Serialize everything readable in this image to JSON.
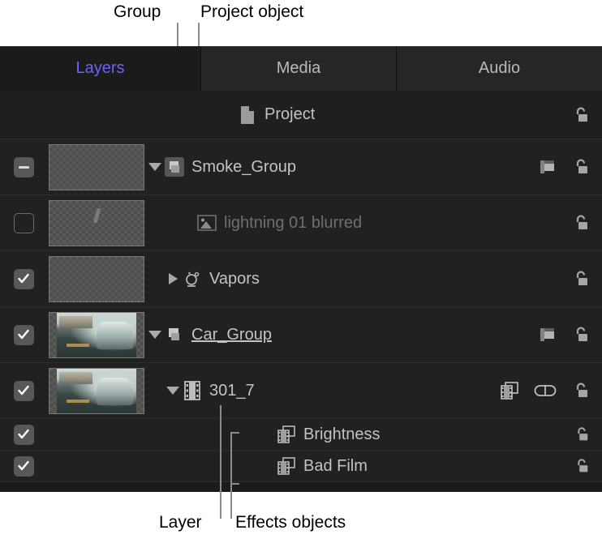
{
  "annotations": {
    "group": "Group",
    "project_object": "Project object",
    "layer": "Layer",
    "effects_objects": "Effects objects",
    "leader_color": "#8c8c8c"
  },
  "panel": {
    "background": "#1b1b1b",
    "accent": "#6b62ff",
    "tabs": [
      {
        "id": "layers",
        "label": "Layers",
        "selected": true
      },
      {
        "id": "media",
        "label": "Media",
        "selected": false
      },
      {
        "id": "audio",
        "label": "Audio",
        "selected": false
      }
    ],
    "rows": [
      {
        "id": "project",
        "name": "Project",
        "type": "project",
        "icon": "document-icon",
        "checkbox": "none",
        "thumbnail": "none",
        "disclosure": "none",
        "dimmed": false,
        "renaming": false,
        "right_icons": [
          "unlock-icon"
        ]
      },
      {
        "id": "smoke-group",
        "name": "Smoke_Group",
        "type": "group",
        "icon": "group-icon",
        "checkbox": "mixed",
        "thumbnail": "empty",
        "disclosure": "open",
        "dimmed": false,
        "renaming": false,
        "right_icons": [
          "mask-icon",
          "unlock-icon"
        ]
      },
      {
        "id": "lightning-01-blurred",
        "name": "lightning 01 blurred",
        "type": "image",
        "icon": "image-icon",
        "checkbox": "off",
        "thumbnail": "lightning",
        "disclosure": "none",
        "dimmed": true,
        "renaming": false,
        "right_icons": [
          "unlock-icon"
        ]
      },
      {
        "id": "vapors",
        "name": "Vapors",
        "type": "emitter",
        "icon": "emitter-icon",
        "checkbox": "on",
        "thumbnail": "empty",
        "disclosure": "closed",
        "dimmed": false,
        "renaming": false,
        "right_icons": [
          "unlock-icon"
        ]
      },
      {
        "id": "car-group",
        "name": "Car_Group",
        "type": "group",
        "icon": "group-icon",
        "checkbox": "on",
        "thumbnail": "car",
        "disclosure": "open",
        "dimmed": false,
        "renaming": true,
        "right_icons": [
          "mask-icon",
          "unlock-icon"
        ]
      },
      {
        "id": "301-7",
        "name": "301_7",
        "type": "layer",
        "icon": "film-icon",
        "checkbox": "on",
        "thumbnail": "car",
        "disclosure": "open",
        "dimmed": false,
        "renaming": false,
        "right_icons": [
          "filter-icon",
          "link-icon",
          "unlock-icon"
        ]
      },
      {
        "id": "brightness",
        "name": "Brightness",
        "type": "effect",
        "icon": "effect-icon",
        "checkbox": "on",
        "thumbnail": "none",
        "disclosure": "none",
        "dimmed": false,
        "renaming": false,
        "right_icons": [
          "unlock-icon"
        ]
      },
      {
        "id": "bad-film",
        "name": "Bad Film",
        "type": "effect",
        "icon": "effect-icon",
        "checkbox": "on",
        "thumbnail": "none",
        "disclosure": "none",
        "dimmed": false,
        "renaming": false,
        "right_icons": [
          "unlock-icon"
        ]
      }
    ]
  }
}
